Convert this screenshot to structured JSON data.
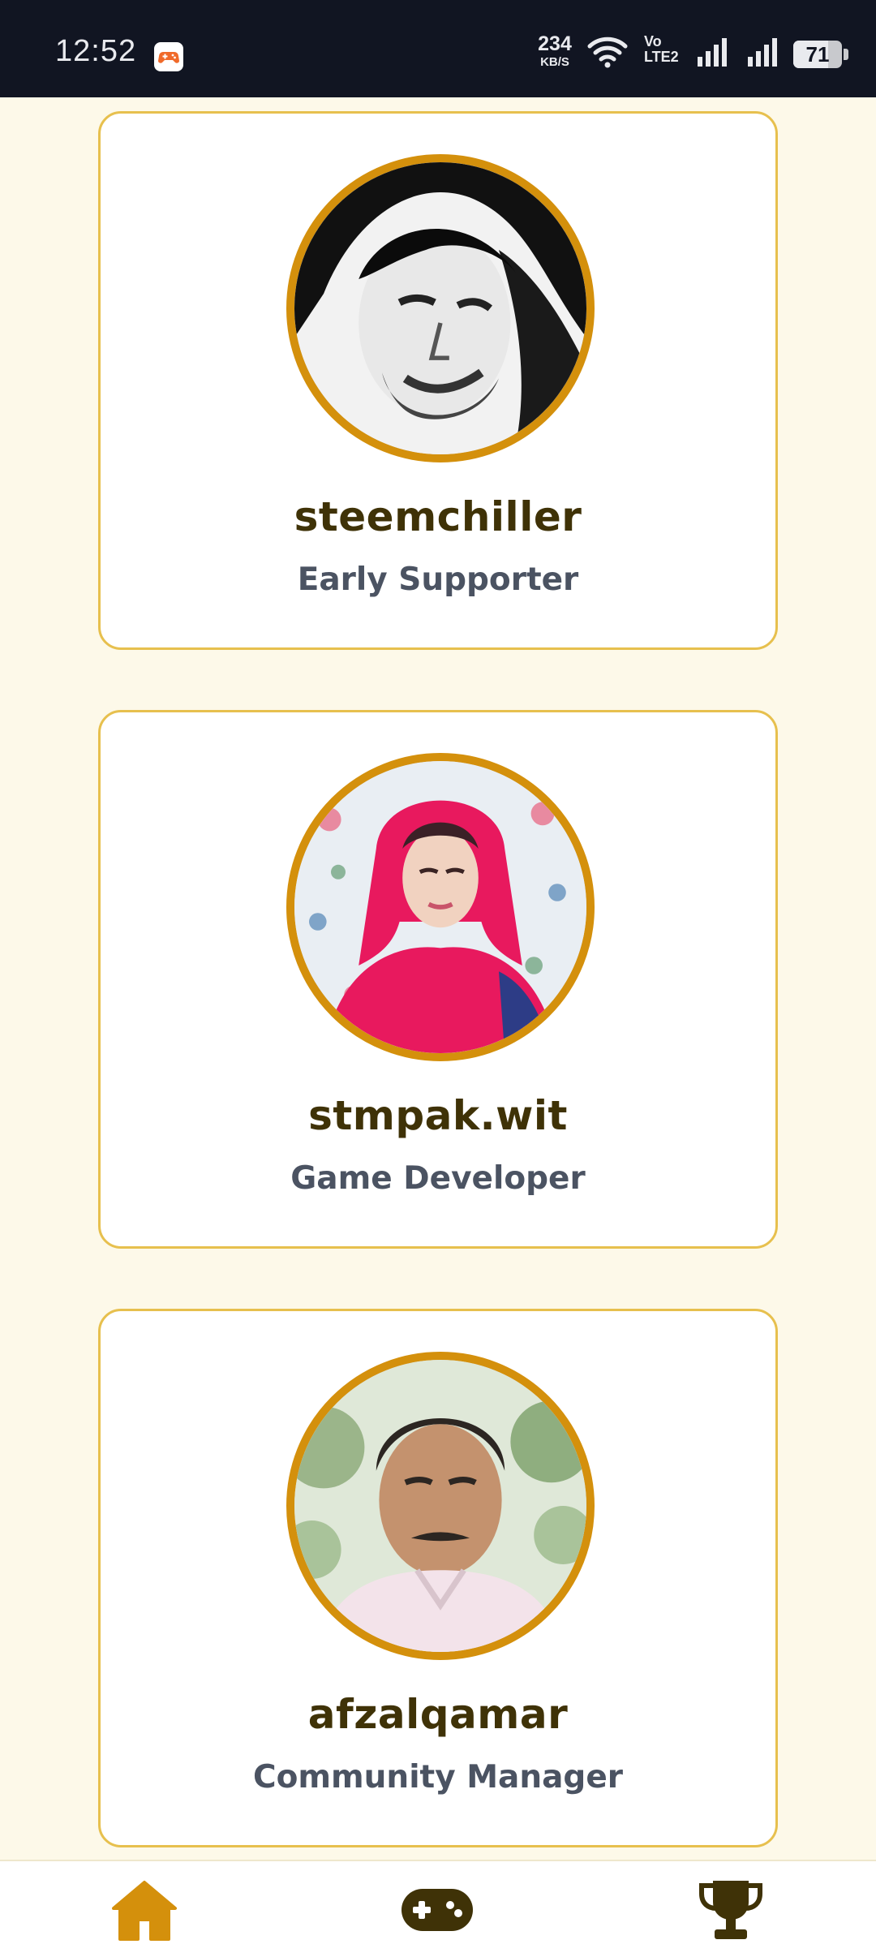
{
  "status_bar": {
    "time": "12:52",
    "app_icon": "game-controller-icon",
    "net_speed_value": "234",
    "net_speed_unit": "KB/S",
    "volte_line1": "Vo",
    "volte_line2": "LTE2",
    "battery": "71",
    "battery_level": 0.71
  },
  "team": [
    {
      "name": "steemchiller",
      "role": "Early Supporter"
    },
    {
      "name": "stmpak.wit",
      "role": "Game Developer"
    },
    {
      "name": "afzalqamar",
      "role": "Community Manager"
    }
  ],
  "bottom_nav": {
    "items": [
      {
        "icon": "home-icon",
        "active": true
      },
      {
        "icon": "gamepad-icon",
        "active": false
      },
      {
        "icon": "trophy-icon",
        "active": false
      }
    ]
  },
  "colors": {
    "background": "#fdf9e9",
    "card_border": "#e7c04e",
    "avatar_ring": "#d4900c",
    "name_text": "#3f3207",
    "role_text": "#4b5362",
    "nav_active": "#d4900c",
    "nav_inactive": "#3f3207",
    "status_bar": "#111522"
  }
}
